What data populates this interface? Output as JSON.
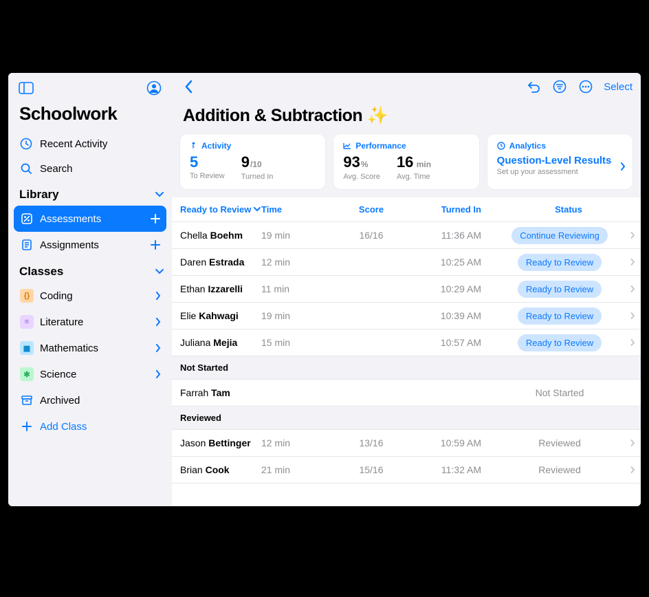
{
  "app_title": "Schoolwork",
  "sidebar": {
    "recent": "Recent Activity",
    "search": "Search",
    "library_header": "Library",
    "assessments": "Assessments",
    "assignments": "Assignments",
    "classes_header": "Classes",
    "classes": [
      "Coding",
      "Literature",
      "Mathematics",
      "Science"
    ],
    "archived": "Archived",
    "add_class": "Add Class"
  },
  "toolbar": {
    "select": "Select"
  },
  "page_title": "Addition & Subtraction ✨",
  "cards": {
    "activity": {
      "label": "Activity",
      "to_review_n": "5",
      "to_review_lbl": "To Review",
      "turned_in_n": "9",
      "turned_in_of": "/10",
      "turned_in_lbl": "Turned In"
    },
    "performance": {
      "label": "Performance",
      "avg_score_n": "93",
      "avg_score_unit": "%",
      "avg_score_lbl": "Avg. Score",
      "avg_time_n": "16",
      "avg_time_unit": " min",
      "avg_time_lbl": "Avg. Time"
    },
    "analytics": {
      "label": "Analytics",
      "title": "Question-Level Results",
      "sub": "Set up your assessment"
    }
  },
  "columns": {
    "c1": "Ready to Review",
    "c2": "Time",
    "c3": "Score",
    "c4": "Turned In",
    "c5": "Status"
  },
  "rows": [
    {
      "fn": "Chella",
      "ln": "Boehm",
      "time": "19 min",
      "score": "16/16",
      "turned": "11:36 AM",
      "status": "Continue Reviewing",
      "pill": true
    },
    {
      "fn": "Daren",
      "ln": "Estrada",
      "time": "12 min",
      "score": "",
      "turned": "10:25 AM",
      "status": "Ready to Review",
      "pill": true
    },
    {
      "fn": "Ethan",
      "ln": "Izzarelli",
      "time": "11 min",
      "score": "",
      "turned": "10:29 AM",
      "status": "Ready to Review",
      "pill": true
    },
    {
      "fn": "Elie",
      "ln": "Kahwagi",
      "time": "19 min",
      "score": "",
      "turned": "10:39 AM",
      "status": "Ready to Review",
      "pill": true
    },
    {
      "fn": "Juliana",
      "ln": "Mejia",
      "time": "15 min",
      "score": "",
      "turned": "10:57 AM",
      "status": "Ready to Review",
      "pill": true
    }
  ],
  "sections": {
    "not_started": "Not Started",
    "reviewed": "Reviewed"
  },
  "not_started_rows": [
    {
      "fn": "Farrah",
      "ln": "Tam",
      "status": "Not Started"
    }
  ],
  "reviewed_rows": [
    {
      "fn": "Jason",
      "ln": "Bettinger",
      "time": "12 min",
      "score": "13/16",
      "turned": "10:59 AM",
      "status": "Reviewed"
    },
    {
      "fn": "Brian",
      "ln": "Cook",
      "time": "21 min",
      "score": "15/16",
      "turned": "11:32 AM",
      "status": "Reviewed"
    }
  ]
}
